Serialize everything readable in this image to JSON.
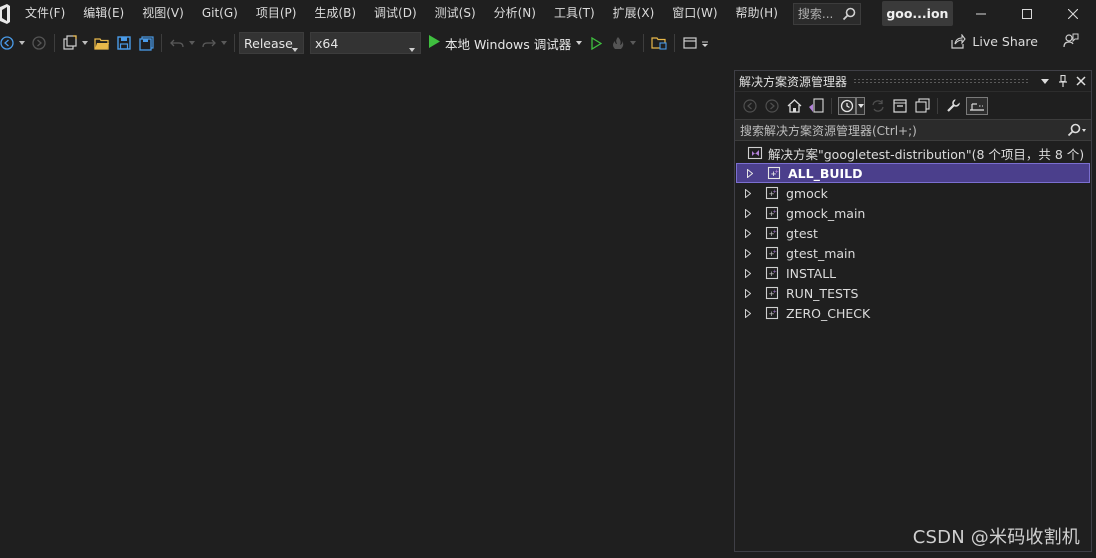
{
  "menubar": {
    "items": [
      "文件(F)",
      "编辑(E)",
      "视图(V)",
      "Git(G)",
      "项目(P)",
      "生成(B)",
      "调试(D)",
      "测试(S)",
      "分析(N)",
      "工具(T)",
      "扩展(X)",
      "窗口(W)",
      "帮助(H)"
    ],
    "search_placeholder": "搜索...",
    "window_title": "goo...ion"
  },
  "toolbar": {
    "configuration": "Release",
    "platform": "x64",
    "run_target": "本地 Windows 调试器",
    "live_share": "Live Share"
  },
  "solution_explorer": {
    "title": "解决方案资源管理器",
    "search_placeholder": "搜索解决方案资源管理器(Ctrl+;)",
    "solution_label": "解决方案\"googletest-distribution\"(8 个项目，共 8 个)",
    "projects": [
      "ALL_BUILD",
      "gmock",
      "gmock_main",
      "gtest",
      "gtest_main",
      "INSTALL",
      "RUN_TESTS",
      "ZERO_CHECK"
    ],
    "selected_project": "ALL_BUILD"
  },
  "watermark": "CSDN @米码收割机",
  "colors": {
    "background": "#1f1f1f",
    "selection": "#4b3f8c",
    "selection_border": "#7b6fd0",
    "run_green": "#3fbf3f",
    "vs_purple": "#b180d7"
  }
}
